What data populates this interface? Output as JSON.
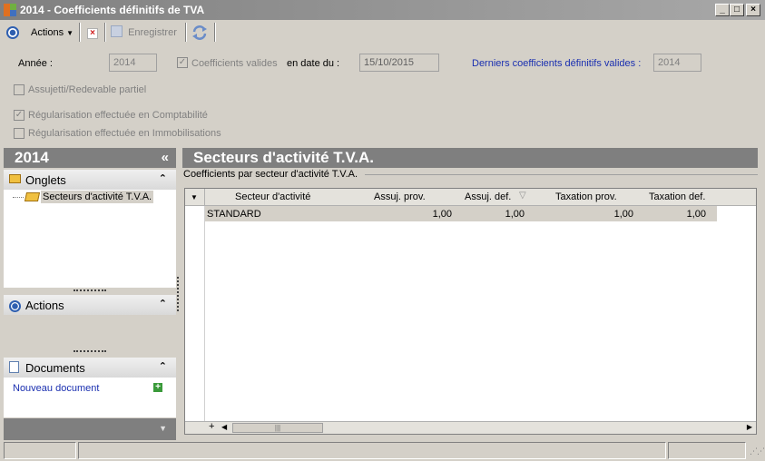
{
  "window": {
    "title": "2014 - Coefficients définitifs de TVA",
    "minimize_glyph": "_",
    "maximize_glyph": "□",
    "close_glyph": "×"
  },
  "toolbar": {
    "actions_label": "Actions",
    "save_label": "Enregistrer"
  },
  "form": {
    "annee_label": "Année :",
    "annee_value": "2014",
    "coeff_valides_label": "Coefficients valides",
    "coeff_valides_checked": true,
    "en_date_label": "en date du :",
    "date_value": "15/10/2015",
    "derniers_label": "Derniers coefficients définitifs valides :",
    "derniers_value": "2014",
    "assujetti_label": "Assujetti/Redevable partiel",
    "assujetti_checked": false,
    "regul_compta_label": "Régularisation effectuée en Comptabilité",
    "regul_compta_checked": true,
    "regul_immo_label": "Régularisation effectuée en Immobilisations",
    "regul_immo_checked": false
  },
  "left_panel": {
    "year": "2014",
    "collapse_glyph": "«",
    "onglets_title": "Onglets",
    "onglets_items": [
      "Secteurs d'activité T.V.A."
    ],
    "actions_title": "Actions",
    "documents_title": "Documents",
    "new_document_label": "Nouveau document",
    "chevron_glyph": "⌃"
  },
  "main": {
    "title": "Secteurs d'activité T.V.A.",
    "group_caption": "Coefficients par secteur d'activité T.V.A.",
    "columns": [
      "Secteur d'activité",
      "Assuj. prov.",
      "Assuj. def.",
      "Taxation prov.",
      "Taxation def."
    ],
    "rows": [
      {
        "secteur": "STANDARD",
        "assuj_prov": "1,00",
        "assuj_def": "1,00",
        "tax_prov": "1,00",
        "tax_def": "1,00"
      }
    ],
    "add_glyph": "+"
  },
  "colors": {
    "title_bar": "#808080",
    "panel_header": "#7f7f7f",
    "link_blue": "#1a2fb0",
    "window_bg": "#d4d0c8"
  }
}
